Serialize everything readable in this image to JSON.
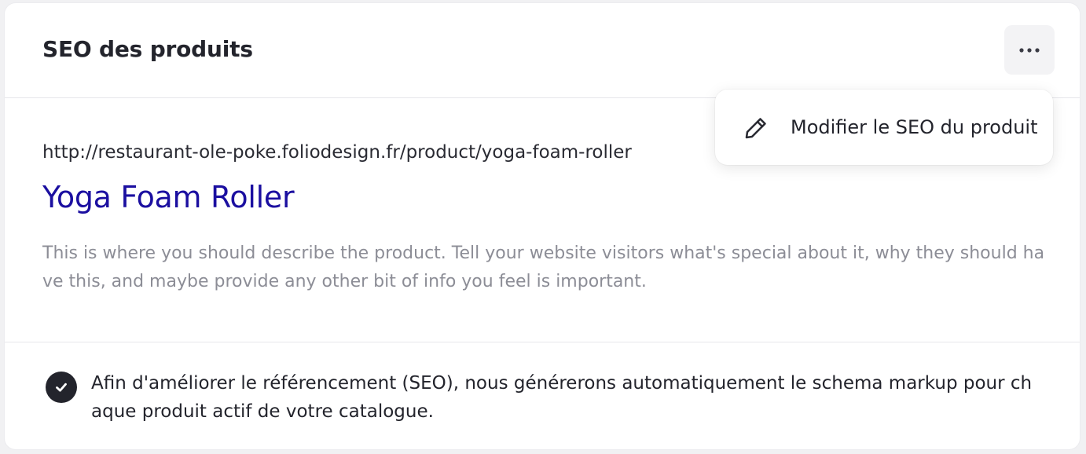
{
  "card": {
    "title": "SEO des produits",
    "more_button_icon": "more-horizontal-icon"
  },
  "menu": {
    "items": [
      {
        "icon": "pencil-icon",
        "label": "Modifier le SEO du produit"
      }
    ]
  },
  "preview": {
    "url": "http://restaurant-ole-poke.foliodesign.fr/product/yoga-foam-roller",
    "title": "Yoga Foam Roller",
    "description": "This is where you should describe the product. Tell your website visitors what's special about it, why they should have this, and maybe provide any other bit of info you feel is important."
  },
  "footer": {
    "icon": "check-circle-icon",
    "text": "Afin d'améliorer le référencement (SEO), nous générerons automatiquement le schema markup pour chaque produit actif de votre catalogue."
  },
  "colors": {
    "link_title": "#1b0fa0",
    "description": "#8c8d96",
    "text": "#23242c"
  }
}
